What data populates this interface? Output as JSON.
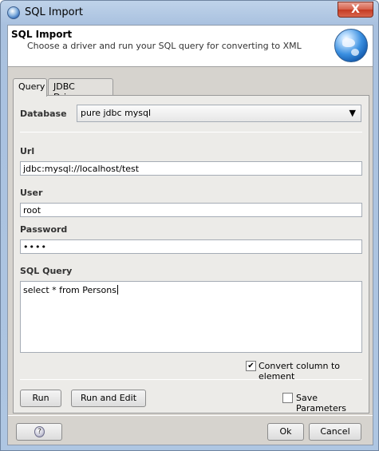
{
  "window": {
    "title": "SQL Import",
    "close_label": "X"
  },
  "header": {
    "title": "SQL Import",
    "description": "Choose a driver and run your SQL query for converting to XML"
  },
  "tabs": [
    {
      "label": "Query",
      "active": true
    },
    {
      "label": "JDBC Drivers",
      "active": false
    }
  ],
  "form": {
    "database_label": "Database",
    "database_value": "pure jdbc mysql",
    "url_label": "Url",
    "url_value": "jdbc:mysql://localhost/test",
    "user_label": "User",
    "user_value": "root",
    "password_label": "Password",
    "password_value": "••••",
    "sql_label": "SQL Query",
    "sql_value": "select * from Persons",
    "convert_label": "Convert column to element",
    "convert_checked": true,
    "save_params_label": "Save Parameters",
    "save_params_checked": false
  },
  "actions": {
    "run_label": "Run",
    "run_edit_label": "Run and Edit",
    "ok_label": "Ok",
    "cancel_label": "Cancel",
    "help_label": "?"
  },
  "icons": {
    "title": "app-globe-icon",
    "header": "globe-icon",
    "dropdown": "chevron-down-icon",
    "help": "help-icon"
  }
}
